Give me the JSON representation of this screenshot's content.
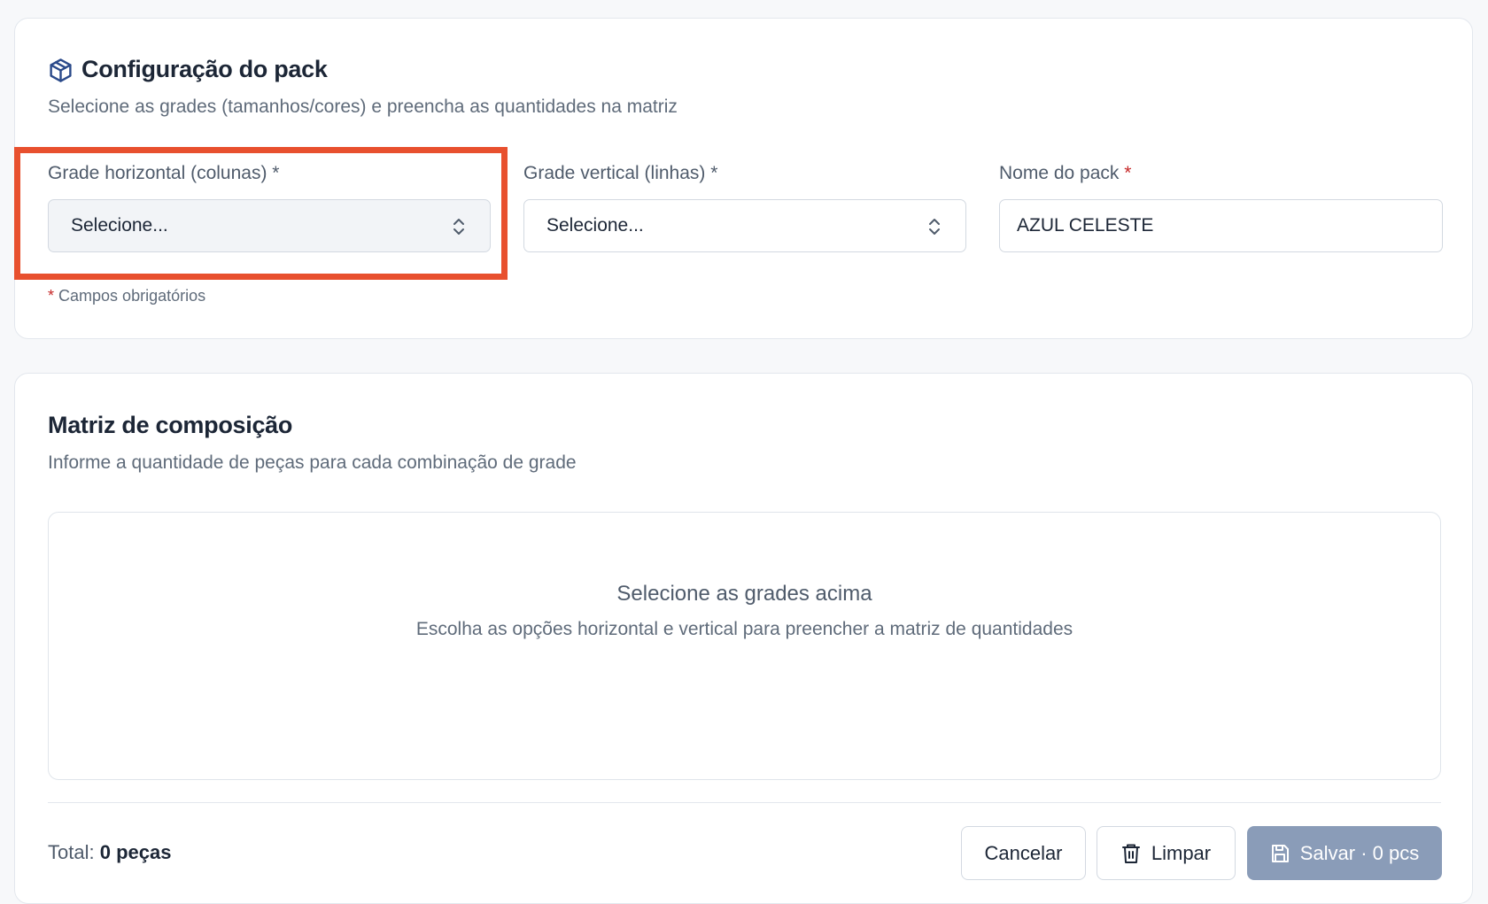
{
  "config": {
    "title": "Configuração do pack",
    "subtitle": "Selecione as grades (tamanhos/cores) e preencha as quantidades na matriz",
    "horizontal": {
      "label": "Grade horizontal (colunas) *",
      "value": "Selecione..."
    },
    "vertical": {
      "label": "Grade vertical (linhas) *",
      "value": "Selecione..."
    },
    "pack_name": {
      "label": "Nome do pack",
      "required_mark": "*",
      "value": "AZUL CELESTE"
    },
    "required_note_mark": "*",
    "required_note": "Campos obrigatórios"
  },
  "matrix": {
    "title": "Matriz de composição",
    "subtitle": "Informe a quantidade de peças para cada combinação de grade",
    "empty_title": "Selecione as grades acima",
    "empty_desc": "Escolha as opções horizontal e vertical para preencher a matriz de quantidades"
  },
  "footer": {
    "total_label": "Total:",
    "total_value": "0 peças",
    "cancel": "Cancelar",
    "clear": "Limpar",
    "save": "Salvar · 0 pcs"
  },
  "colors": {
    "highlight": "#e8502e",
    "save_button": "#8a9cb8",
    "required": "#c62828"
  },
  "icons": [
    "package-icon",
    "chevron-up-down-icon",
    "trash-icon",
    "save-icon"
  ]
}
